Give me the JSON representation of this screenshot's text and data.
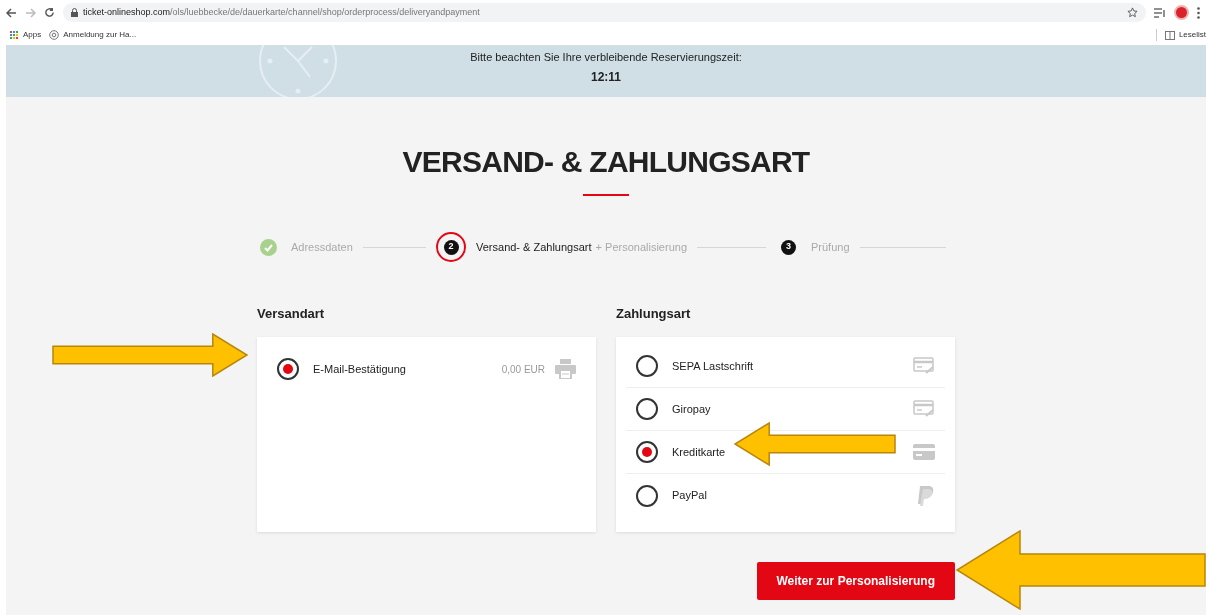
{
  "browser": {
    "url_host": "ticket-onlineshop.com",
    "url_path": "/ols/luebbecke/de/dauerkarte/channel/shop/orderprocess/deliveryandpayment",
    "bookmarks": [
      "Apps",
      "Anmeldung zur Ha..."
    ],
    "reading_list": "Leselist"
  },
  "reservation": {
    "notice": "Bitte beachten Sie Ihre verbleibende Reservierungszeit:",
    "time": "12:11"
  },
  "title": "VERSAND- & ZAHLUNGSART",
  "steps": [
    {
      "completed": true,
      "selected": false,
      "label": "Adressdaten"
    },
    {
      "completed": false,
      "selected": true,
      "number": "2",
      "label": "Versand- & Zahlungsart",
      "suffix": "+ Personalisierung"
    },
    {
      "completed": false,
      "selected": false,
      "number": "3",
      "label": "Prüfung"
    }
  ],
  "shipping": {
    "heading": "Versandart",
    "options": [
      {
        "label": "E-Mail-Bestätigung",
        "price": "0,00 EUR",
        "selected": true
      }
    ]
  },
  "payment": {
    "heading": "Zahlungsart",
    "options": [
      {
        "label": "SEPA Lastschrift",
        "selected": false
      },
      {
        "label": "Giropay",
        "selected": false
      },
      {
        "label": "Kreditkarte",
        "selected": true
      },
      {
        "label": "PayPal",
        "selected": false
      }
    ]
  },
  "next_button": "Weiter zur Personalisierung"
}
